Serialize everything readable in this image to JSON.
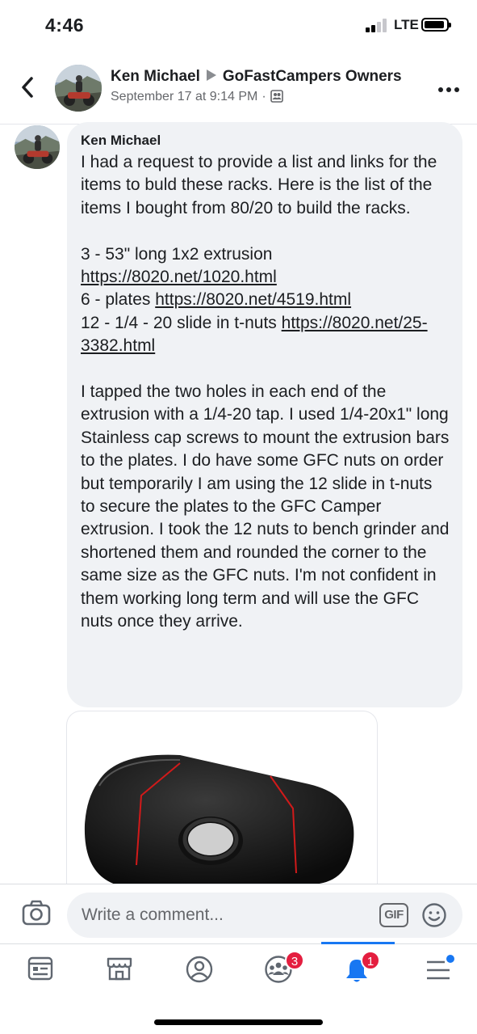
{
  "status_bar": {
    "time": "4:46",
    "network": "LTE"
  },
  "post_header": {
    "author": "Ken Michael",
    "group": "GoFastCampers Owners",
    "date": "September 17 at 9:14 PM",
    "separator": "·"
  },
  "comment": {
    "author": "Ken Michael",
    "intro": "I had a request to provide a list and links for the items to buld these racks. Here is the list of the items I bought from 80/20 to build the racks.",
    "items": [
      {
        "text": "3 - 53\" long 1x2 extrusion ",
        "link": "https://8020.net/1020.html"
      },
      {
        "text": "6 - plates ",
        "link": "https://8020.net/4519.html"
      },
      {
        "text": "12 - 1/4 - 20 slide in t-nuts ",
        "link": "https://8020.net/25-3382.html"
      }
    ],
    "body": "I tapped the two holes in each end of the extrusion with a 1/4-20 tap. I used 1/4-20x1\" long Stainless cap screws to mount the extrusion bars to the plates. I do have some GFC nuts on order but temporarily I am using the 12 slide in t-nuts to secure the plates to the GFC Camper extrusion. I took the 12 nuts to bench grinder and shortened them and rounded the corner to the same size as the GFC nuts. I'm not confident in them working long term and will use the GFC nuts once they arrive."
  },
  "composer": {
    "placeholder": "Write a comment...",
    "gif_label": "GIF"
  },
  "tab_bar": {
    "tabs": [
      {
        "name": "news-feed",
        "icon": "news-feed-icon"
      },
      {
        "name": "marketplace",
        "icon": "marketplace-icon"
      },
      {
        "name": "profile",
        "icon": "profile-icon"
      },
      {
        "name": "groups",
        "icon": "groups-icon",
        "badge": "3"
      },
      {
        "name": "notifications",
        "icon": "bell-icon",
        "badge": "1",
        "active": true
      },
      {
        "name": "menu",
        "icon": "menu-icon"
      }
    ]
  },
  "colors": {
    "accent": "#1877f2",
    "badge": "#e41e3f",
    "bubble": "#f0f2f5",
    "text": "#1c1e21",
    "secondary": "#65676b"
  }
}
